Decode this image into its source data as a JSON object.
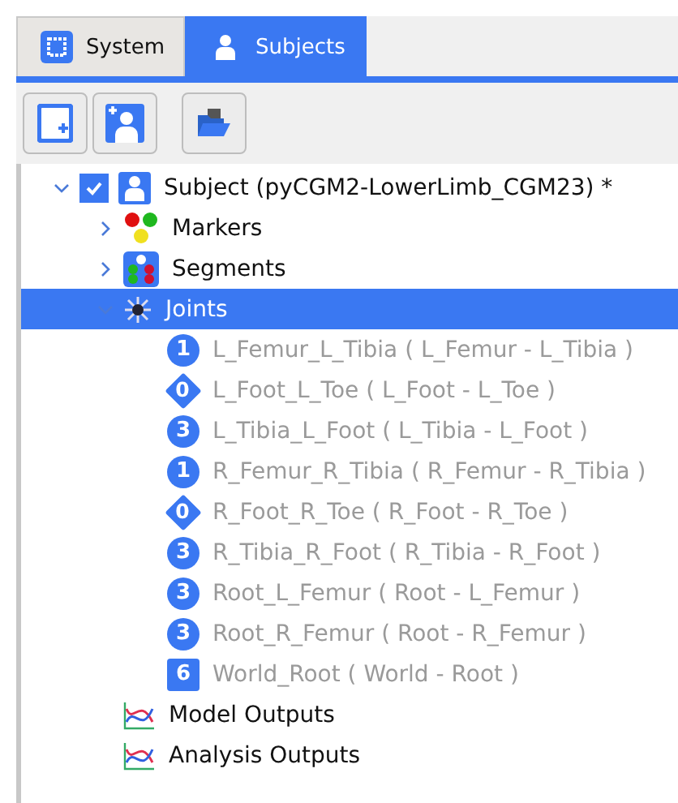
{
  "tabs": [
    {
      "label": "System",
      "kind": "system",
      "selected": false
    },
    {
      "label": "Subjects",
      "kind": "person",
      "selected": true
    }
  ],
  "toolbar": [
    {
      "kind": "new-doc"
    },
    {
      "kind": "add-person"
    },
    {
      "kind": "open-folder"
    }
  ],
  "tree": [
    {
      "label": "Subject (pyCGM2-LowerLimb_CGM23) *",
      "kind": "person",
      "expanded": true,
      "checked": true,
      "selected": false,
      "children": [
        {
          "label": "Markers",
          "kind": "markers",
          "expanded": false,
          "selected": false
        },
        {
          "label": "Segments",
          "kind": "segments",
          "expanded": false,
          "selected": false
        },
        {
          "label": "Joints",
          "kind": "joints",
          "expanded": true,
          "selected": true,
          "children": [
            {
              "label": "L_Femur_L_Tibia ( L_Femur - L_Tibia )",
              "badge": "1",
              "kind": "circle",
              "dimmed": true
            },
            {
              "label": "L_Foot_L_Toe ( L_Foot - L_Toe )",
              "badge": "0",
              "kind": "diamond",
              "dimmed": true
            },
            {
              "label": "L_Tibia_L_Foot ( L_Tibia - L_Foot )",
              "badge": "3",
              "kind": "circle",
              "dimmed": true
            },
            {
              "label": "R_Femur_R_Tibia ( R_Femur - R_Tibia )",
              "badge": "1",
              "kind": "circle",
              "dimmed": true
            },
            {
              "label": "R_Foot_R_Toe ( R_Foot - R_Toe )",
              "badge": "0",
              "kind": "diamond",
              "dimmed": true
            },
            {
              "label": "R_Tibia_R_Foot ( R_Tibia - R_Foot )",
              "badge": "3",
              "kind": "circle",
              "dimmed": true
            },
            {
              "label": "Root_L_Femur ( Root - L_Femur )",
              "badge": "3",
              "kind": "circle",
              "dimmed": true
            },
            {
              "label": "Root_R_Femur ( Root - R_Femur )",
              "badge": "3",
              "kind": "circle",
              "dimmed": true
            },
            {
              "label": "World_Root ( World - Root )",
              "badge": "6",
              "kind": "square",
              "dimmed": true
            }
          ]
        },
        {
          "label": "Model Outputs",
          "kind": "graph",
          "selected": false
        },
        {
          "label": "Analysis Outputs",
          "kind": "graph",
          "selected": false
        }
      ]
    }
  ]
}
